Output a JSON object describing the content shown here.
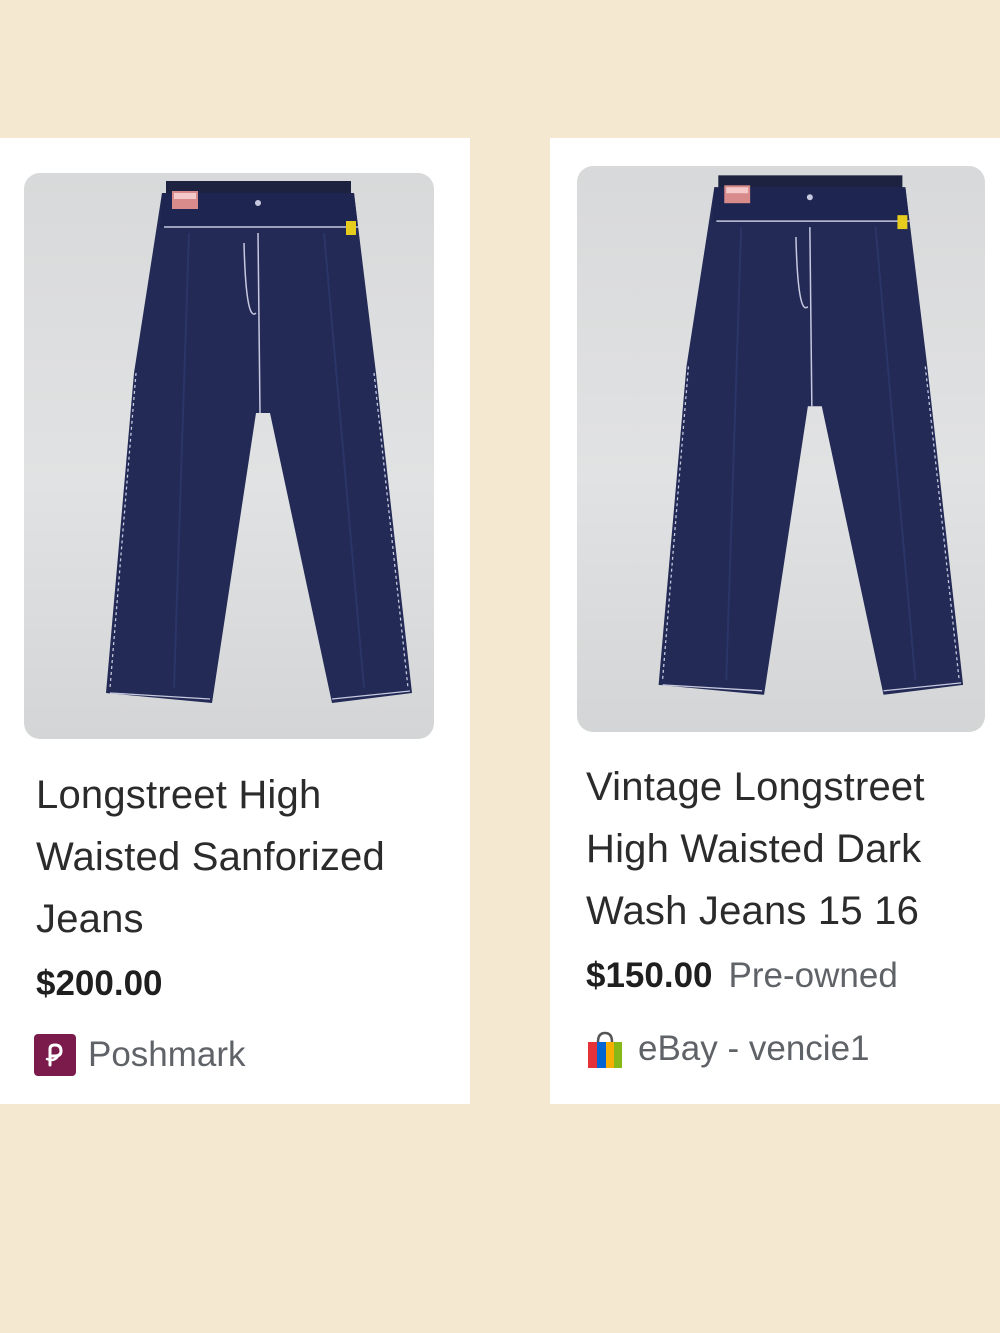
{
  "listings": [
    {
      "title_lines": [
        "Longstreet High",
        "Waisted Sanforized",
        "Jeans"
      ],
      "price": "$200.00",
      "condition": "",
      "seller": "Poshmark",
      "seller_icon": "poshmark-logo-icon",
      "brand_color": "#7b1b4b"
    },
    {
      "title_lines": [
        "Vintage Longstreet",
        "High Waisted Dark",
        "Wash Jeans 15 16"
      ],
      "price": "$150.00",
      "condition": "Pre-owned",
      "seller": "eBay - vencie1",
      "seller_icon": "ebay-shopping-bag-icon",
      "brand_colors": [
        "#e53238",
        "#0064d2",
        "#f5af02",
        "#86b817"
      ]
    }
  ]
}
